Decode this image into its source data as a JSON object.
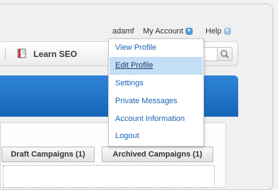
{
  "user_links": {
    "username": "adamf",
    "my_account": "My Account",
    "help": "Help"
  },
  "toolbar": {
    "learn_seo": "Learn SEO",
    "book_icon": "book-icon",
    "search_icon": "magnifier-icon"
  },
  "account_menu": {
    "items": [
      {
        "label": "View Profile"
      },
      {
        "label": "Edit Profile",
        "highlighted": true
      },
      {
        "label": "Settings"
      },
      {
        "label": "Private Messages"
      },
      {
        "label": "Account Information"
      },
      {
        "label": "Logout"
      }
    ]
  },
  "tabs": [
    {
      "label": "Draft Campaigns (1)"
    },
    {
      "label": "Archived Campaigns (1)"
    }
  ],
  "colors": {
    "accent_blue": "#1f75cc",
    "menu_highlight": "#c4def5",
    "link_blue": "#1d64b5"
  }
}
